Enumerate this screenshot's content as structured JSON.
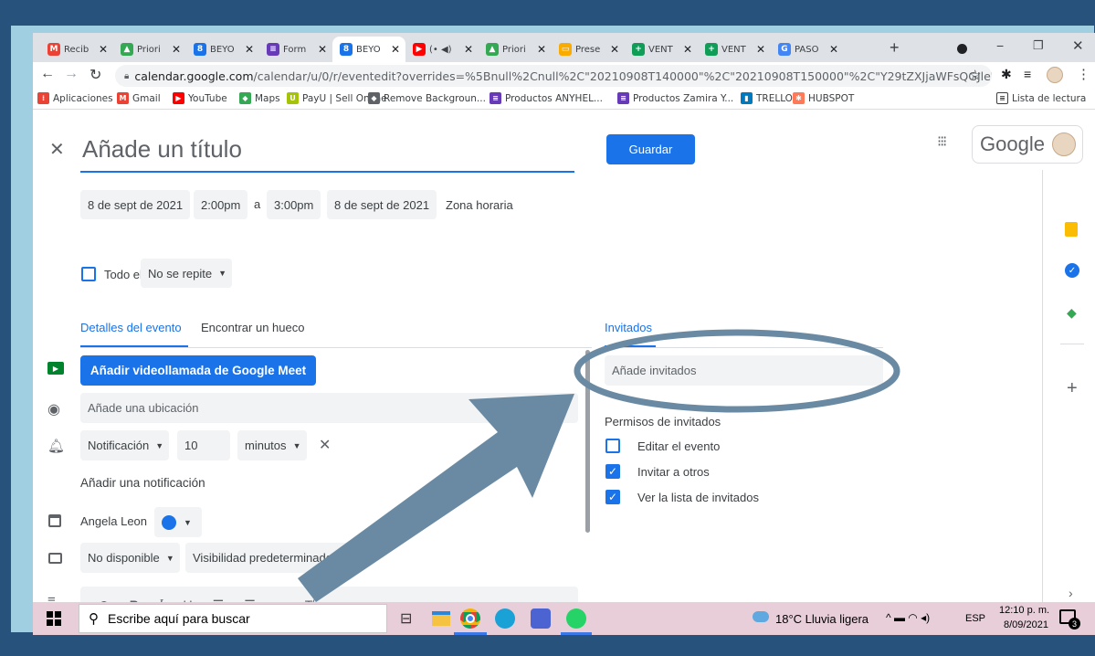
{
  "browser": {
    "tabs": [
      {
        "icon": "gmail-icon",
        "color": "#ea4335",
        "glyph": "M",
        "label": "Recib"
      },
      {
        "icon": "drive-icon",
        "color": "#34a853",
        "glyph": "▲",
        "label": "Priori"
      },
      {
        "icon": "calendar-icon",
        "color": "#1a73e8",
        "glyph": "8",
        "label": "BEYO"
      },
      {
        "icon": "forms-icon",
        "color": "#673ab7",
        "glyph": "≡",
        "label": "Form"
      },
      {
        "icon": "calendar-icon",
        "color": "#1a73e8",
        "glyph": "8",
        "label": "BEYO"
      },
      {
        "icon": "youtube-icon",
        "color": "#ff0000",
        "glyph": "▶",
        "label": "(• ◀)"
      },
      {
        "icon": "drive-icon",
        "color": "#34a853",
        "glyph": "▲",
        "label": "Priori"
      },
      {
        "icon": "slides-icon",
        "color": "#f9ab00",
        "glyph": "▭",
        "label": "Prese"
      },
      {
        "icon": "sheets-icon",
        "color": "#0f9d58",
        "glyph": "+",
        "label": "VENT"
      },
      {
        "icon": "sheets-icon",
        "color": "#0f9d58",
        "glyph": "+",
        "label": "VENT"
      },
      {
        "icon": "google-icon",
        "color": "#4285f4",
        "glyph": "G",
        "label": "PASO"
      }
    ],
    "new_tab": "+",
    "url_host": "calendar.google.com",
    "url_path": "/calendar/u/0/r/eventedit?overrides=%5Bnull%2Cnull%2C\"20210908T140000\"%2C\"20210908T150000\"%2C\"Y29tZXJjaWFsQGJleW91...",
    "bookmarks": [
      {
        "icon": "apps-grid-icon",
        "color": "#ea4335",
        "glyph": "⁞",
        "label": "Aplicaciones"
      },
      {
        "icon": "gmail-icon",
        "color": "#ea4335",
        "glyph": "M",
        "label": "Gmail"
      },
      {
        "icon": "youtube-icon",
        "color": "#ff0000",
        "glyph": "▶",
        "label": "YouTube"
      },
      {
        "icon": "maps-icon",
        "color": "#34a853",
        "glyph": "◆",
        "label": "Maps"
      },
      {
        "icon": "payu-icon",
        "color": "#a6c307",
        "glyph": "U",
        "label": "PayU | Sell Online"
      },
      {
        "icon": "remove-bg-icon",
        "color": "#5f6368",
        "glyph": "◆",
        "label": "Remove Backgroun..."
      },
      {
        "icon": "forms-icon",
        "color": "#673ab7",
        "glyph": "≡",
        "label": "Productos ANYHEL..."
      },
      {
        "icon": "forms-icon",
        "color": "#673ab7",
        "glyph": "≡",
        "label": "Productos Zamira Y..."
      },
      {
        "icon": "trello-icon",
        "color": "#0079bf",
        "glyph": "▮",
        "label": "TRELLO"
      },
      {
        "icon": "hubspot-icon",
        "color": "#ff7a59",
        "glyph": "✱",
        "label": "HUBSPOT"
      }
    ],
    "reading_list": "Lista de lectura"
  },
  "event": {
    "title_placeholder": "Añade un título",
    "save_label": "Guardar",
    "google_label": "Google",
    "start_date": "8 de sept de 2021",
    "start_time": "2:00pm",
    "separator": "a",
    "end_time": "3:00pm",
    "end_date": "8 de sept de 2021",
    "timezone": "Zona horaria",
    "all_day": "Todo el día",
    "repeat": "No se repite",
    "tab_details": "Detalles del evento",
    "tab_find": "Encontrar un hueco",
    "meet_button": "Añadir videollamada de Google Meet",
    "location_placeholder": "Añade una ubicación",
    "notification_type": "Notificación",
    "notification_value": "10",
    "notification_unit": "minutos",
    "add_notification": "Añadir una notificación",
    "calendar_owner": "Angela Leon",
    "availability": "No disponible",
    "visibility": "Visibilidad predeterminada"
  },
  "guests": {
    "heading": "Invitados",
    "input_placeholder": "Añade invitados",
    "permissions_heading": "Permisos de invitados",
    "permissions": [
      {
        "label": "Editar el evento",
        "checked": false
      },
      {
        "label": "Invitar a otros",
        "checked": true
      },
      {
        "label": "Ver la lista de invitados",
        "checked": true
      }
    ]
  },
  "taskbar": {
    "search_placeholder": "Escribe aquí para buscar",
    "weather": "18°C  Lluvia ligera",
    "language": "ESP",
    "time": "12:10 p. m.",
    "date": "8/09/2021",
    "notifications_count": "3"
  },
  "colors": {
    "accent": "#1a73e8",
    "frame": "#26527b",
    "annotation": "#6a8aa3"
  }
}
